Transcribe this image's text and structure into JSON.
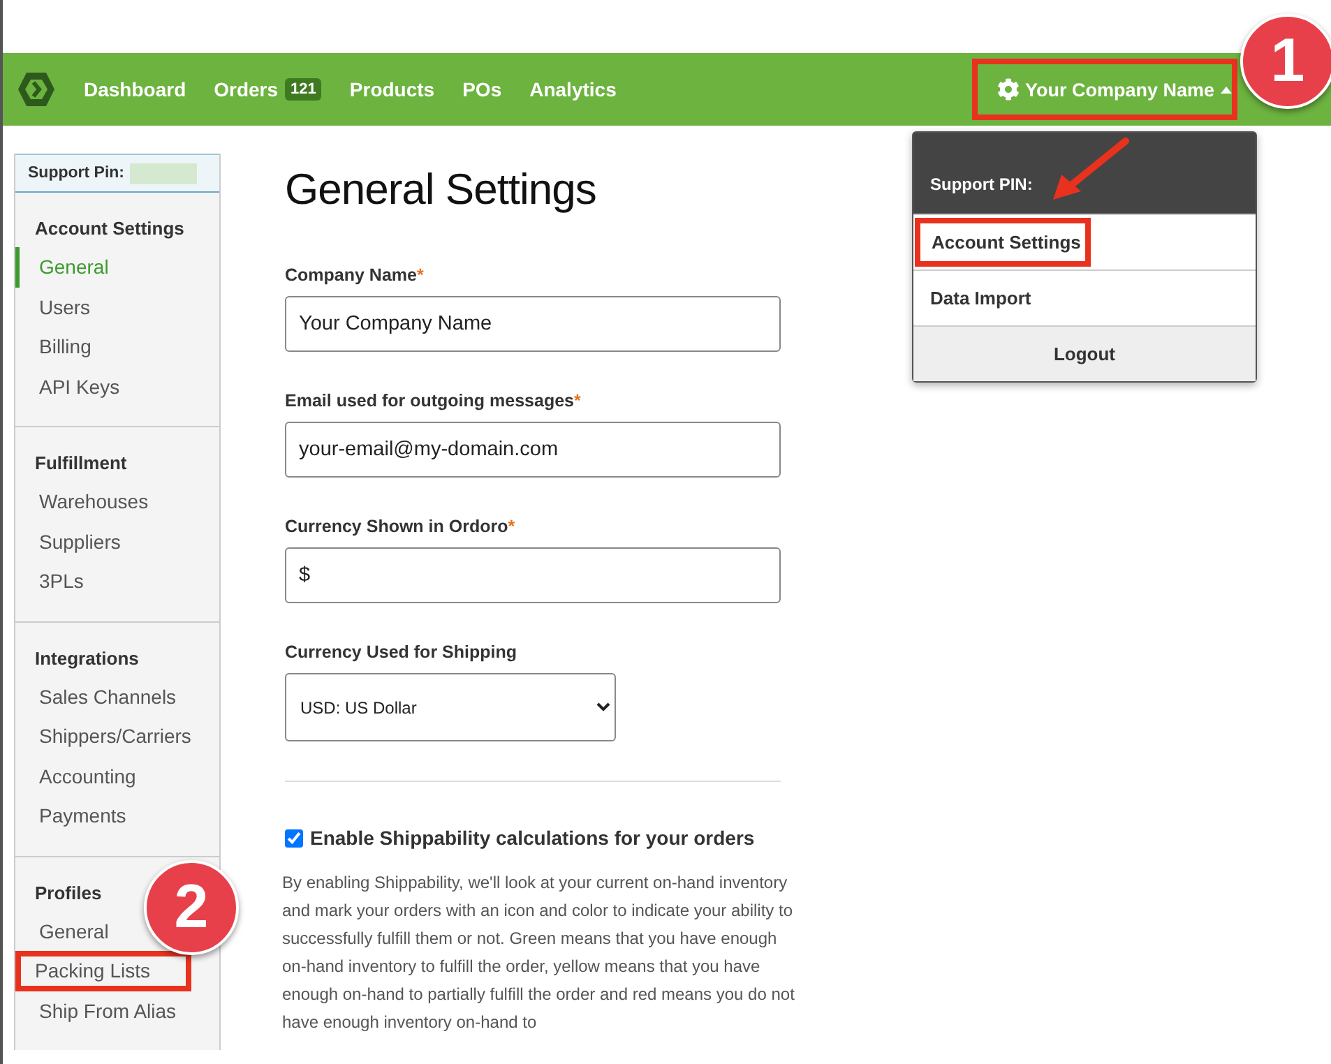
{
  "nav": {
    "items": [
      {
        "label": "Dashboard"
      },
      {
        "label": "Orders",
        "badge": "121"
      },
      {
        "label": "Products"
      },
      {
        "label": "POs"
      },
      {
        "label": "Analytics"
      }
    ],
    "account_menu": {
      "label": "Your Company Name",
      "highlighted": true,
      "callout": "1",
      "expanded": true
    }
  },
  "dropdown": {
    "header": "Support PIN:",
    "items": [
      {
        "label": "Account Settings",
        "kind": "item",
        "highlighted": true
      },
      {
        "label": "Data Import",
        "kind": "item",
        "highlighted": false
      },
      {
        "label": "Logout",
        "kind": "logout",
        "highlighted": false
      }
    ]
  },
  "sidebar": {
    "support_pin": "Support Pin:",
    "sections": [
      {
        "heading": "Account Settings",
        "items": [
          {
            "label": "General",
            "selected": true,
            "highlighted": false
          },
          {
            "label": "Users",
            "selected": false,
            "highlighted": false
          },
          {
            "label": "Billing",
            "selected": false,
            "highlighted": false
          },
          {
            "label": "API Keys",
            "selected": false,
            "highlighted": false
          }
        ]
      },
      {
        "heading": "Fulfillment",
        "items": [
          {
            "label": "Warehouses",
            "selected": false,
            "highlighted": false
          },
          {
            "label": "Suppliers",
            "selected": false,
            "highlighted": false
          },
          {
            "label": "3PLs",
            "selected": false,
            "highlighted": false
          }
        ]
      },
      {
        "heading": "Integrations",
        "items": [
          {
            "label": "Sales Channels",
            "selected": false,
            "highlighted": false
          },
          {
            "label": "Shippers/Carriers",
            "selected": false,
            "highlighted": false
          },
          {
            "label": "Accounting",
            "selected": false,
            "highlighted": false
          },
          {
            "label": "Payments",
            "selected": false,
            "highlighted": false
          }
        ]
      },
      {
        "heading": "Profiles",
        "callout": "2",
        "items": [
          {
            "label": "General",
            "selected": false,
            "highlighted": false
          },
          {
            "label": "Packing Lists",
            "selected": false,
            "highlighted": true
          },
          {
            "label": "Ship From Alias",
            "selected": false,
            "highlighted": false
          }
        ]
      }
    ]
  },
  "page": {
    "title": "General Settings",
    "fields": [
      {
        "label": "Company Name",
        "mark": "*",
        "kind": "text",
        "value": "Your Company Name"
      },
      {
        "label": "Email used for outgoing messages",
        "mark": "*",
        "kind": "text",
        "value": "your-email@my-domain.com"
      },
      {
        "label": "Currency Shown in Ordoro",
        "mark": "*",
        "kind": "text",
        "value": "$"
      },
      {
        "label": "Currency Used for Shipping",
        "kind": "select",
        "value": "USD: US Dollar"
      }
    ],
    "shippability": {
      "label": "Enable Shippability calculations for your orders",
      "checked": true,
      "description": "By enabling Shippability, we'll look at your current on-hand inventory and mark your orders with an icon and color to indicate your ability to successfully fulfill them or not. Green means that you have enough on-hand inventory to fulfill the order, yellow means that you have enough on-hand to partially fulfill the order and red means you do not have enough inventory on-hand to"
    }
  }
}
